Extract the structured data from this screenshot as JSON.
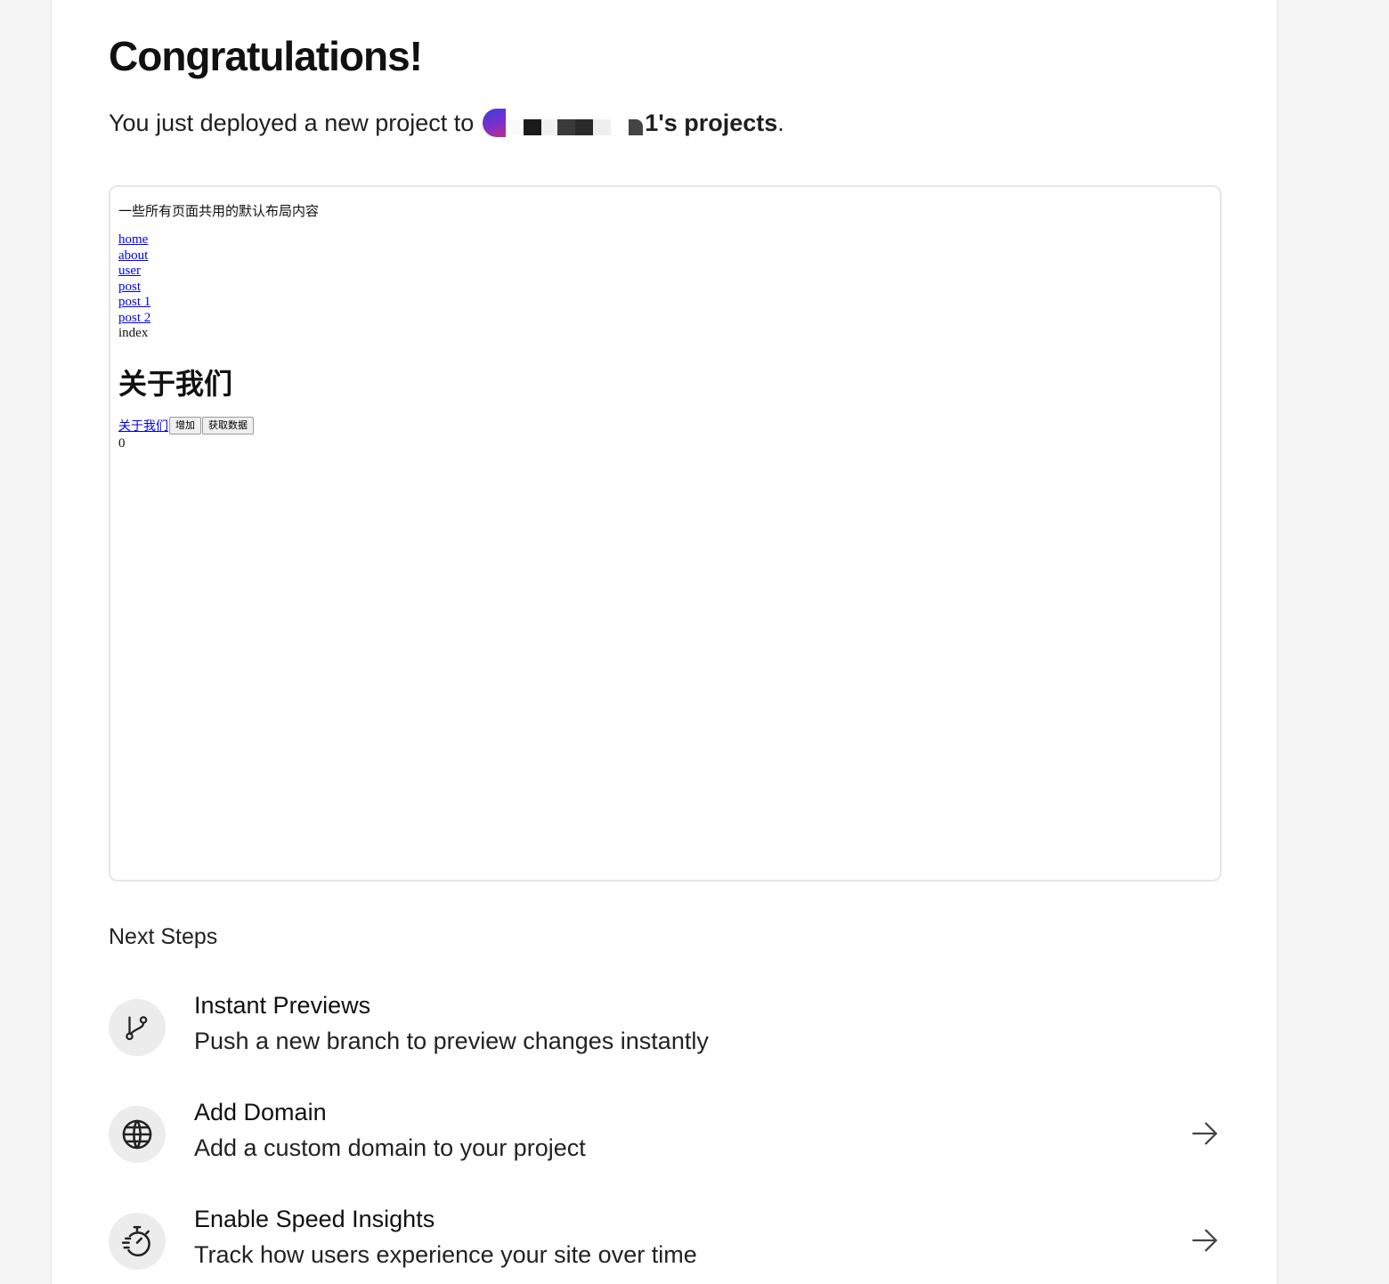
{
  "header": {
    "title": "Congratulations!",
    "subtitle_prefix": "You just deployed a new project to",
    "team_name_suffix": "1's projects",
    "subtitle_end": "."
  },
  "preview": {
    "layout_text": "一些所有页面共用的默认布局内容",
    "nav_links": [
      "home",
      "about",
      "user",
      "post",
      "post 1",
      "post 2"
    ],
    "nav_current": "index",
    "heading": "关于我们",
    "link": "关于我们",
    "buttons": [
      "增加",
      "获取数据"
    ],
    "count": "0"
  },
  "next_steps": {
    "title": "Next Steps",
    "items": [
      {
        "icon": "git-branch-icon",
        "title": "Instant Previews",
        "description": "Push a new branch to preview changes instantly",
        "has_arrow": false
      },
      {
        "icon": "globe-icon",
        "title": "Add Domain",
        "description": "Add a custom domain to your project",
        "has_arrow": true
      },
      {
        "icon": "speed-timer-icon",
        "title": "Enable Speed Insights",
        "description": "Track how users experience your site over time",
        "has_arrow": true
      }
    ]
  }
}
